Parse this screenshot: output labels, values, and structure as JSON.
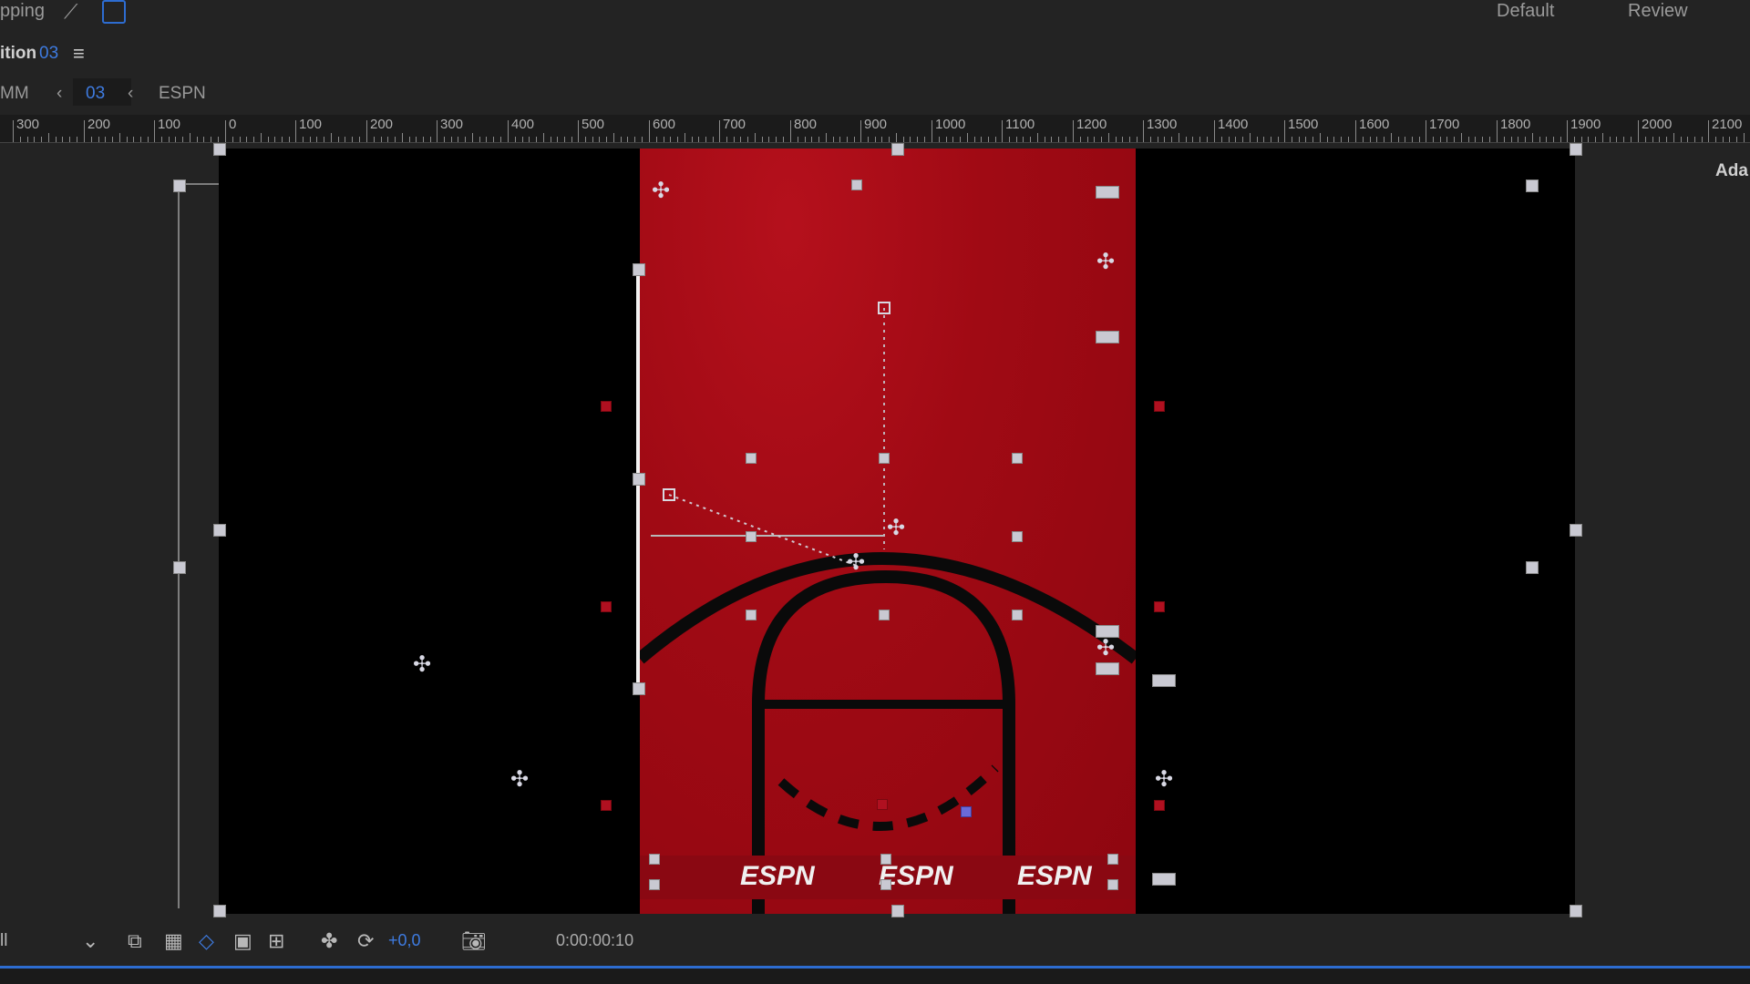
{
  "topbar": {
    "snapping_label": "pping",
    "workspaces": [
      "Default",
      "Review"
    ]
  },
  "composition": {
    "title_prefix": "ition",
    "number": "03",
    "menu_icon": "hamburger-icon"
  },
  "breadcrumbs": {
    "items": [
      "MM",
      "03",
      "ESPN"
    ]
  },
  "ruler": {
    "labels": [
      "300",
      "200",
      "100",
      "0",
      "100",
      "200",
      "300",
      "400",
      "500",
      "600",
      "700",
      "800",
      "900",
      "1000",
      "1100",
      "1200",
      "1300",
      "1400",
      "1500",
      "1600",
      "1700",
      "1800",
      "1900",
      "2000",
      "2100"
    ]
  },
  "right_panel": {
    "label": "Ada"
  },
  "banner": {
    "logo_text": "ESPN"
  },
  "bottom_toolbar": {
    "resolution": "ll",
    "exposure": "+0,0",
    "timecode": "0:00:00:10"
  },
  "colors": {
    "accent": "#2d6cd0",
    "comp_red": "#a00a14",
    "pasteboard": "#000000",
    "ui_bg": "#232323"
  }
}
